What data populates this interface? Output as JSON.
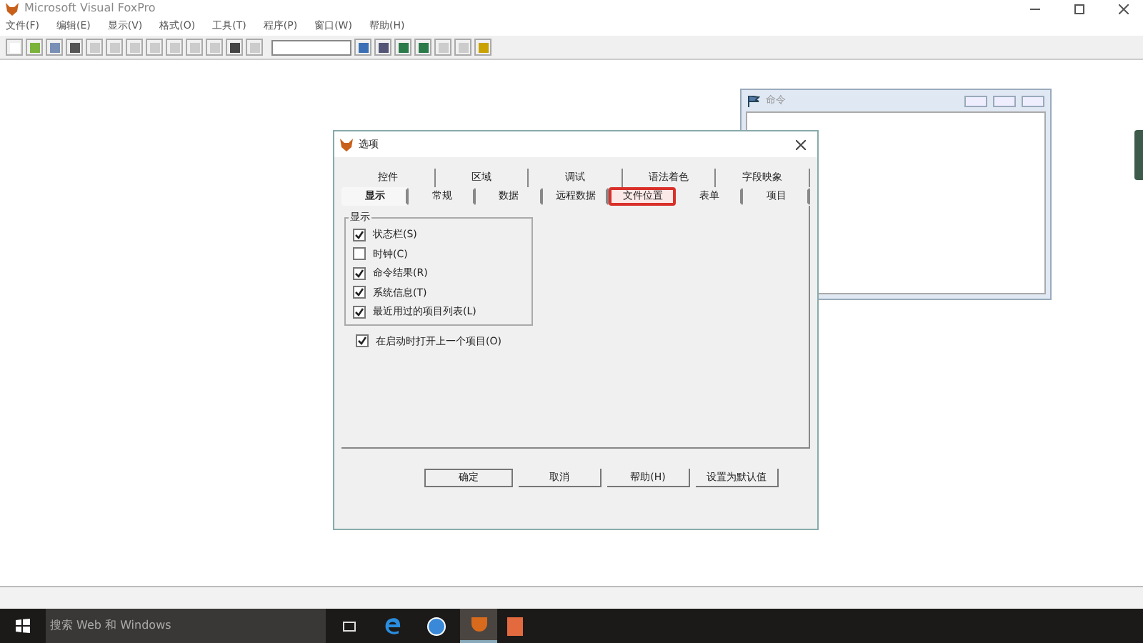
{
  "window": {
    "title": "Microsoft Visual FoxPro"
  },
  "menu": [
    "文件(F)",
    "编辑(E)",
    "显示(V)",
    "格式(O)",
    "工具(T)",
    "程序(P)",
    "窗口(W)",
    "帮助(H)"
  ],
  "command_window": {
    "title": "命令"
  },
  "dialog": {
    "title": "选项",
    "tabs_back": [
      {
        "label": "控件",
        "selected": false
      },
      {
        "label": "区域",
        "selected": false
      },
      {
        "label": "调试",
        "selected": false
      },
      {
        "label": "语法着色",
        "selected": false
      },
      {
        "label": "字段映象",
        "selected": false
      }
    ],
    "tabs_front": [
      {
        "label": "显示",
        "selected": true,
        "highlighted": false
      },
      {
        "label": "常规",
        "selected": false,
        "highlighted": false
      },
      {
        "label": "数据",
        "selected": false,
        "highlighted": false
      },
      {
        "label": "远程数据",
        "selected": false,
        "highlighted": false
      },
      {
        "label": "文件位置",
        "selected": false,
        "highlighted": true
      },
      {
        "label": "表单",
        "selected": false,
        "highlighted": false
      },
      {
        "label": "项目",
        "selected": false,
        "highlighted": false
      }
    ],
    "group": {
      "title": "显示",
      "options": [
        {
          "label": "状态栏(S)",
          "checked": true
        },
        {
          "label": "时钟(C)",
          "checked": false
        },
        {
          "label": "命令结果(R)",
          "checked": true
        },
        {
          "label": "系统信息(T)",
          "checked": true
        },
        {
          "label": "最近用过的项目列表(L)",
          "checked": true
        }
      ]
    },
    "standalone_option": {
      "label": "在启动时打开上一个项目(O)",
      "checked": true
    },
    "buttons": [
      {
        "label": "确定",
        "default": true
      },
      {
        "label": "取消",
        "default": false
      },
      {
        "label": "帮助(H)",
        "default": false
      },
      {
        "label": "设置为默认值",
        "default": false
      }
    ]
  },
  "taskbar": {
    "search_placeholder": "搜索 Web 和 Windows"
  }
}
